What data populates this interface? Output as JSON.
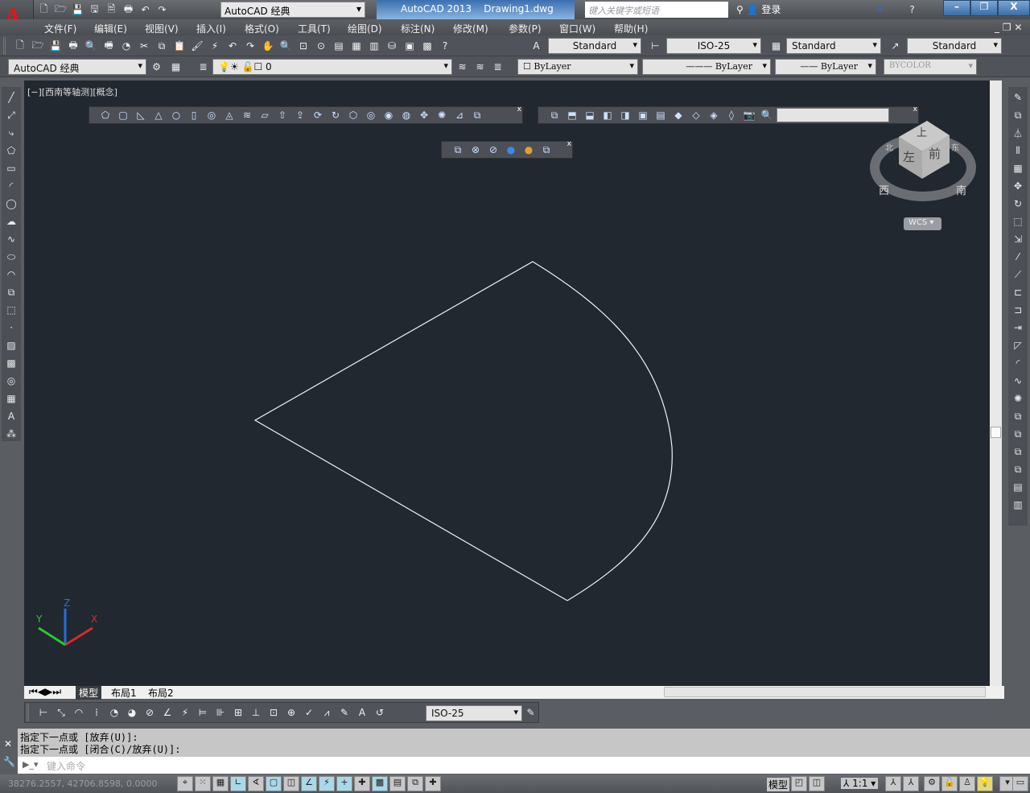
{
  "app": {
    "logo": "A",
    "title": "AutoCAD 2013    Drawing1.dwg",
    "workspace": "AutoCAD 经典",
    "search_placeholder": "键入关键字或短语",
    "login": "登录",
    "window_buttons": [
      "minimize-icon",
      "restore-icon",
      "close-icon"
    ]
  },
  "quick_access": [
    "new-icon",
    "open-icon",
    "save-icon",
    "saveas-icon",
    "publish-icon",
    "plot-icon",
    "undo-icon",
    "redo-icon"
  ],
  "menu": [
    "文件(F)",
    "编辑(E)",
    "视图(V)",
    "插入(I)",
    "格式(O)",
    "工具(T)",
    "绘图(D)",
    "标注(N)",
    "修改(M)",
    "参数(P)",
    "窗口(W)",
    "帮助(H)"
  ],
  "styles": {
    "text_style": "Standard",
    "dim_style": "ISO-25",
    "table_style": "Standard",
    "mleader_style": "Standard"
  },
  "layers": {
    "workspace": "AutoCAD 经典",
    "layer": "0",
    "color": "ByLayer",
    "linetype": "ByLayer",
    "lineweight": "ByLayer",
    "plotstyle": "BYCOLOR"
  },
  "viewport_label": "[−][西南等轴测][概念]",
  "viewcube": {
    "top": "上",
    "left": "左",
    "front": "前",
    "north": "北",
    "east": "东",
    "west": "西",
    "south": "南",
    "ucs": "WCS"
  },
  "ucs_axes": {
    "x": "X",
    "y": "Y",
    "z": "Z"
  },
  "layout_tabs": [
    "模型",
    "布局1",
    "布局2"
  ],
  "dim_toolbar": {
    "dim_style": "ISO-25"
  },
  "command": {
    "history": [
      "指定下一点或 [放弃(U)]:",
      "指定下一点或 [闭合(C)/放弃(U)]:"
    ],
    "placeholder": "键入命令"
  },
  "status": {
    "coords": "38276.2557, 42706.8598, 0.0000",
    "model": "模型",
    "scale": "1:1"
  },
  "colors": {
    "canvas": "#212830",
    "accent": "#3b6fb0"
  }
}
